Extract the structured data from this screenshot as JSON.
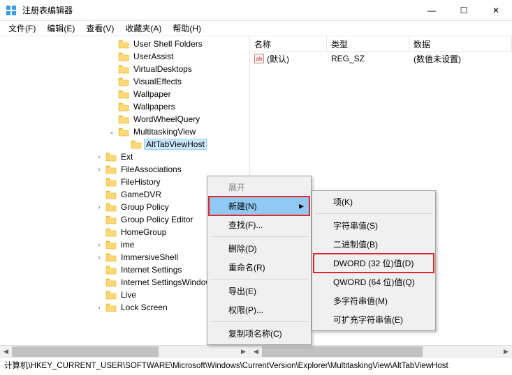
{
  "window": {
    "title": "注册表编辑器",
    "controls": {
      "min": "—",
      "max": "☐",
      "close": "✕"
    }
  },
  "menubar": [
    "文件(F)",
    "编辑(E)",
    "查看(V)",
    "收藏夹(A)",
    "帮助(H)"
  ],
  "tree": [
    {
      "indent": 3,
      "exp": "",
      "label": "User Shell Folders"
    },
    {
      "indent": 3,
      "exp": "",
      "label": "UserAssist"
    },
    {
      "indent": 3,
      "exp": "",
      "label": "VirtualDesktops"
    },
    {
      "indent": 3,
      "exp": "",
      "label": "VisualEffects"
    },
    {
      "indent": 3,
      "exp": "",
      "label": "Wallpaper"
    },
    {
      "indent": 3,
      "exp": "",
      "label": "Wallpapers"
    },
    {
      "indent": 3,
      "exp": "",
      "label": "WordWheelQuery"
    },
    {
      "indent": 3,
      "exp": "v",
      "label": "MultitaskingView"
    },
    {
      "indent": 4,
      "exp": "",
      "label": "AltTabViewHost",
      "selected": true
    },
    {
      "indent": 2,
      "exp": ">",
      "label": "Ext"
    },
    {
      "indent": 2,
      "exp": ">",
      "label": "FileAssociations"
    },
    {
      "indent": 2,
      "exp": "",
      "label": "FileHistory"
    },
    {
      "indent": 2,
      "exp": "",
      "label": "GameDVR"
    },
    {
      "indent": 2,
      "exp": ">",
      "label": "Group Policy"
    },
    {
      "indent": 2,
      "exp": "",
      "label": "Group Policy Editor"
    },
    {
      "indent": 2,
      "exp": "",
      "label": "HomeGroup"
    },
    {
      "indent": 2,
      "exp": ">",
      "label": "ime"
    },
    {
      "indent": 2,
      "exp": ">",
      "label": "ImmersiveShell"
    },
    {
      "indent": 2,
      "exp": "",
      "label": "Internet Settings"
    },
    {
      "indent": 2,
      "exp": "",
      "label": "Internet SettingsWindows"
    },
    {
      "indent": 2,
      "exp": "",
      "label": "Live"
    },
    {
      "indent": 2,
      "exp": ">",
      "label": "Lock Screen"
    }
  ],
  "list": {
    "columns": {
      "name": "名称",
      "type": "类型",
      "data": "数据"
    },
    "rows": [
      {
        "icon": "ab",
        "name": "(默认)",
        "type": "REG_SZ",
        "data": "(数值未设置)"
      }
    ]
  },
  "context_menu": {
    "main": [
      {
        "label": "展开",
        "disabled": true
      },
      {
        "label": "新建(N)",
        "highlighted": true,
        "redbox": true,
        "submenu": true
      },
      {
        "label": "查找(F)..."
      },
      {
        "sep": true
      },
      {
        "label": "删除(D)"
      },
      {
        "label": "重命名(R)"
      },
      {
        "sep": true
      },
      {
        "label": "导出(E)"
      },
      {
        "label": "权限(P)..."
      },
      {
        "sep": true
      },
      {
        "label": "复制项名称(C)"
      }
    ],
    "sub": [
      {
        "label": "项(K)"
      },
      {
        "sep": true
      },
      {
        "label": "字符串值(S)"
      },
      {
        "label": "二进制值(B)"
      },
      {
        "label": "DWORD (32 位)值(D)",
        "redbox": true
      },
      {
        "label": "QWORD (64 位)值(Q)"
      },
      {
        "label": "多字符串值(M)"
      },
      {
        "label": "可扩充字符串值(E)"
      }
    ]
  },
  "statusbar": "计算机\\HKEY_CURRENT_USER\\SOFTWARE\\Microsoft\\Windows\\CurrentVersion\\Explorer\\MultitaskingView\\AltTabViewHost"
}
